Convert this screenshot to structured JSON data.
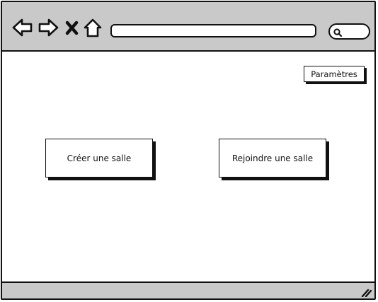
{
  "browser": {
    "icons": [
      "back-icon",
      "forward-icon",
      "close-icon",
      "home-icon"
    ],
    "address": "",
    "search_icon": "search-icon"
  },
  "header": {
    "settings_label": "Paramètres"
  },
  "main": {
    "create_room_label": "Créer une salle",
    "join_room_label": "Rejoindre une salle"
  },
  "colors": {
    "chrome": "#c9c9c9",
    "ink": "#111111",
    "background": "#ffffff"
  }
}
